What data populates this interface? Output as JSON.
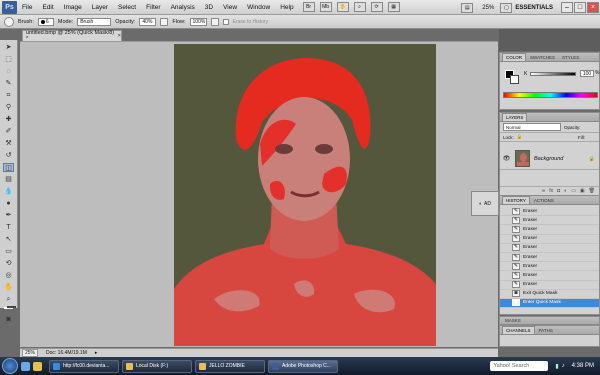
{
  "app": {
    "logo": "Ps",
    "menu": [
      "File",
      "Edit",
      "Image",
      "Layer",
      "Select",
      "Filter",
      "Analysis",
      "3D",
      "View",
      "Window",
      "Help"
    ],
    "zoom": "25%",
    "workspace": "ESSENTIALS"
  },
  "options": {
    "brush_label": "Brush:",
    "brush_size": "6",
    "mode_label": "Mode:",
    "mode_value": "Brush",
    "opacity_label": "Opacity:",
    "opacity_value": "40%",
    "flow_label": "Flow:",
    "flow_value": "100%",
    "erase_history": "Erase to History"
  },
  "document": {
    "tab_title": "untitled.bmp @ 25% (Quick Mask/8) *",
    "tab_close": "×"
  },
  "panels": {
    "color": {
      "tabs": [
        "COLOR",
        "SWATCHES",
        "STYLES"
      ],
      "k_label": "K",
      "k_value": "100",
      "k_unit": "%",
      "k_level": 1.0
    },
    "layers": {
      "tab": "LAYERS",
      "blend_mode": "Normal",
      "opacity_label": "Opacity:",
      "lock_label": "Lock:",
      "fill_label": "Fill:",
      "layer_name": "Background",
      "footer_icons": [
        "fx",
        "◘",
        "◐",
        "▭",
        "▣",
        "🗑"
      ]
    },
    "adjustments": {
      "label": "AD"
    },
    "history": {
      "tabs": [
        "HISTORY",
        "ACTIONS"
      ],
      "items": [
        {
          "label": "Eraser",
          "selected": false
        },
        {
          "label": "Eraser",
          "selected": false
        },
        {
          "label": "Eraser",
          "selected": false
        },
        {
          "label": "Eraser",
          "selected": false
        },
        {
          "label": "Eraser",
          "selected": false
        },
        {
          "label": "Eraser",
          "selected": false
        },
        {
          "label": "Eraser",
          "selected": false
        },
        {
          "label": "Eraser",
          "selected": false
        },
        {
          "label": "Eraser",
          "selected": false
        },
        {
          "label": "Exit Quick Mask",
          "selected": false
        },
        {
          "label": "Enter Quick Mask",
          "selected": true
        }
      ]
    },
    "masks": {
      "tab": "MASKS"
    },
    "channels": {
      "tabs": [
        "CHANNELS",
        "PATHS"
      ]
    }
  },
  "status": {
    "zoom": "25%",
    "doc": "Doc: 16.4M/19.1M"
  },
  "taskbar": {
    "tasks": [
      {
        "label": "http://fc00.devianta...",
        "color": "#3a8be0",
        "active": false
      },
      {
        "label": "Local Disk (F:)",
        "color": "#e7c24a",
        "active": false
      },
      {
        "label": "JELLO ZOMBIE",
        "color": "#e7c24a",
        "active": false
      },
      {
        "label": "Adobe Photoshop C...",
        "color": "#3b5f94",
        "active": true
      }
    ],
    "search_placeholder": "Yahoo! Search",
    "clock": "4:38 PM"
  },
  "colors": {
    "quick_mask": "#e0201a",
    "selection_blue": "#3d8ad8",
    "image_bg": "#55573d"
  }
}
